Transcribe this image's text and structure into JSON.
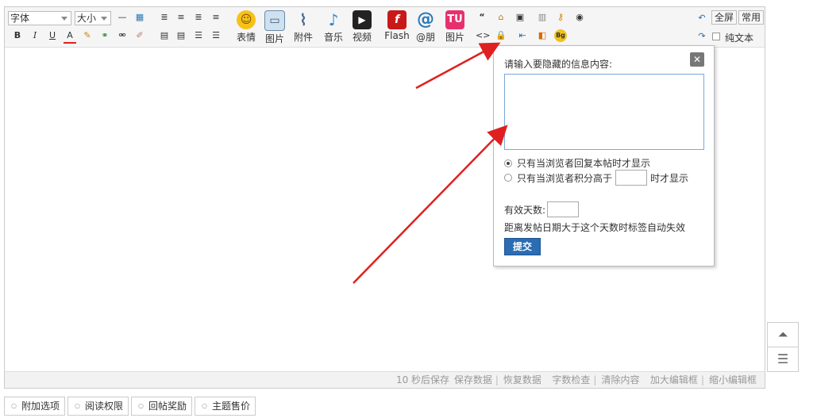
{
  "toolbar": {
    "font_select": "字体",
    "size_select": "大小",
    "media": [
      {
        "label": "表情",
        "icon": "smiley-icon"
      },
      {
        "label": "图片",
        "icon": "image-icon"
      },
      {
        "label": "附件",
        "icon": "paperclip-icon"
      },
      {
        "label": "音乐",
        "icon": "music-note-icon"
      },
      {
        "label": "视频",
        "icon": "video-clapper-icon"
      },
      {
        "label": "Flash",
        "icon": "flash-icon"
      },
      {
        "label": "@朋",
        "icon": "at-icon"
      },
      {
        "label": "图片",
        "icon": "tu-image-icon"
      }
    ],
    "fullscreen": "全屏",
    "common": "常用",
    "plaintext": "纯文本"
  },
  "popup": {
    "label": "请输入要隐藏的信息内容:",
    "close": "✕",
    "radio1": "只有当浏览者回复本帖时才显示",
    "radio2_prefix": "只有当浏览者积分高于",
    "radio2_suffix": "时才显示",
    "days_label": "有效天数:",
    "days_note": "距离发帖日期大于这个天数时标签自动失效",
    "submit": "提交"
  },
  "statusbar": {
    "autosave": "10 秒后保存",
    "save": "保存数据",
    "restore": "恢复数据",
    "wordcount": "字数检查",
    "clear": "清除内容",
    "enlarge": "加大编辑框",
    "shrink": "缩小编辑框"
  },
  "tabs": [
    "附加选项",
    "阅读权限",
    "回帖奖励",
    "主题售价"
  ],
  "colors": {
    "arrow": "#e02020",
    "submit": "#2b6cb3"
  }
}
